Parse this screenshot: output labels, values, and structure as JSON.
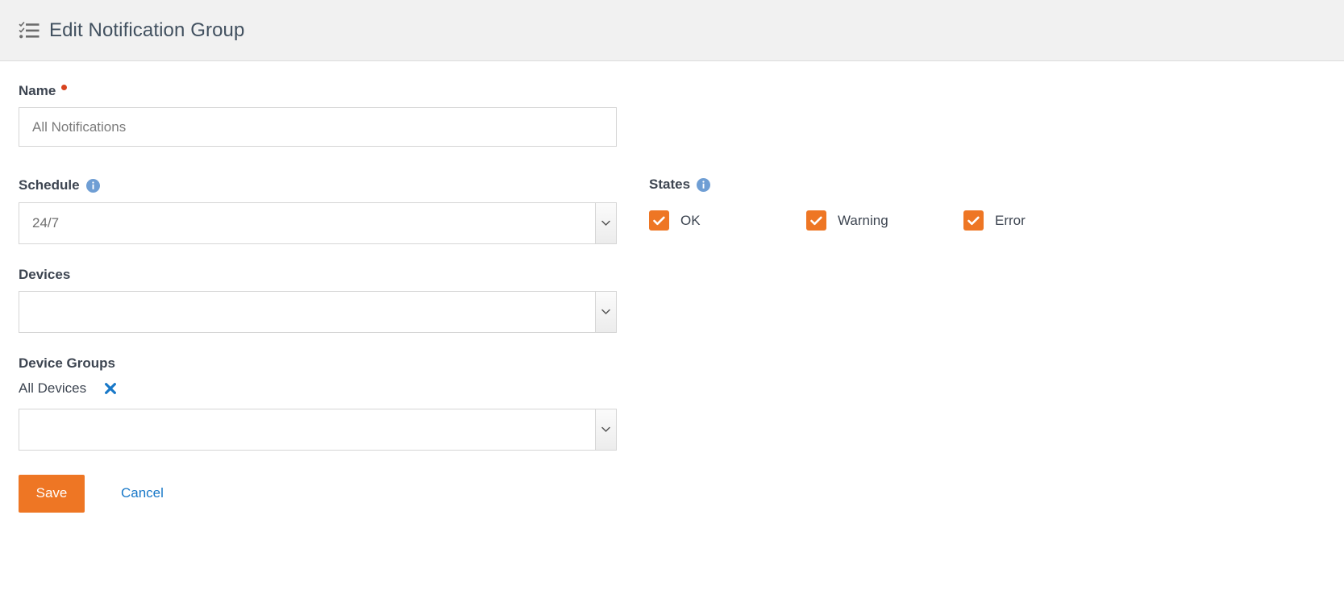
{
  "header": {
    "icon": "checklist-icon",
    "title": "Edit Notification Group"
  },
  "form": {
    "name": {
      "label": "Name",
      "required": true,
      "value": "All Notifications",
      "placeholder": "All Notifications"
    },
    "schedule": {
      "label": "Schedule",
      "info_icon": "info-icon",
      "value": "24/7",
      "arrow_icon": "chevron-down-icon"
    },
    "devices": {
      "label": "Devices",
      "value": "",
      "arrow_icon": "chevron-down-icon"
    },
    "device_groups": {
      "label": "Device Groups",
      "chips": [
        {
          "label": "All Devices",
          "remove_icon": "close-x-icon"
        }
      ],
      "value": "",
      "arrow_icon": "chevron-down-icon"
    }
  },
  "states": {
    "label": "States",
    "info_icon": "info-icon",
    "items": [
      {
        "label": "OK",
        "checked": true
      },
      {
        "label": "Warning",
        "checked": true
      },
      {
        "label": "Error",
        "checked": true
      }
    ]
  },
  "actions": {
    "save_label": "Save",
    "cancel_label": "Cancel"
  },
  "colors": {
    "accent_orange": "#ee7624",
    "link_blue": "#1878c8",
    "required_red": "#d8441f",
    "info_blue": "#6f9ed4",
    "header_bg": "#f1f1f1",
    "text": "#3d4551"
  }
}
